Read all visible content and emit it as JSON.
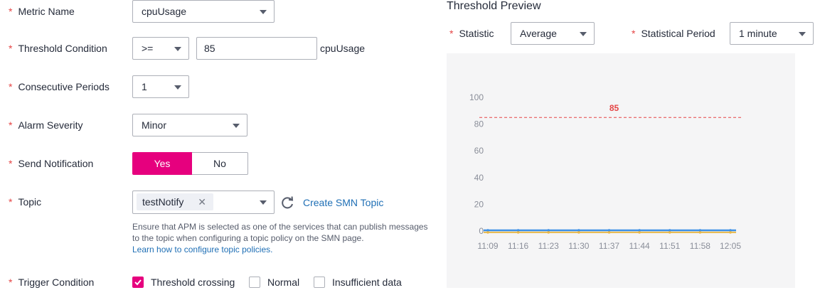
{
  "form": {
    "metric_name": {
      "label": "Metric Name",
      "value": "cpuUsage"
    },
    "threshold_condition": {
      "label": "Threshold Condition",
      "operator": ">=",
      "value": "85",
      "unit": "cpuUsage"
    },
    "consecutive_periods": {
      "label": "Consecutive Periods",
      "value": "1"
    },
    "alarm_severity": {
      "label": "Alarm Severity",
      "value": "Minor"
    },
    "send_notification": {
      "label": "Send Notification",
      "yes": "Yes",
      "no": "No",
      "selected": "Yes"
    },
    "topic": {
      "label": "Topic",
      "tag": "testNotify",
      "tag_remove": "✕",
      "create_link": "Create SMN Topic",
      "hint_line1": "Ensure that APM is selected as one of the services that can publish messages",
      "hint_line2": "to the topic when configuring a topic policy on the SMN page.",
      "hint_link": "Learn how to configure topic policies."
    },
    "trigger_condition": {
      "label": "Trigger Condition",
      "options": [
        {
          "label": "Threshold crossing",
          "checked": true
        },
        {
          "label": "Normal",
          "checked": false
        },
        {
          "label": "Insufficient data",
          "checked": false
        }
      ]
    },
    "required_mark": "*"
  },
  "preview": {
    "title": "Threshold Preview",
    "statistic": {
      "label": "Statistic",
      "value": "Average"
    },
    "period": {
      "label": "Statistical Period",
      "value": "1 minute"
    }
  },
  "colors": {
    "accent": "#e6007e",
    "threshold": "#e54545",
    "series_primary": "#3d8fe6",
    "series_secondary": "#e8b84b",
    "link": "#1f6fb5"
  },
  "chart_data": {
    "type": "line",
    "yticks": [
      "100",
      "80",
      "60",
      "40",
      "20",
      "0"
    ],
    "ylim": [
      0,
      100
    ],
    "x": [
      "11:09",
      "11:16",
      "11:23",
      "11:30",
      "11:37",
      "11:44",
      "11:51",
      "11:58",
      "12:05"
    ],
    "threshold": {
      "value": 85,
      "label": "85"
    },
    "series": [
      {
        "values": [
          0.5,
          0.5,
          0.5,
          0.5,
          0.5,
          0.5,
          0.5,
          0.5,
          0.5
        ]
      },
      {
        "values": [
          -1,
          -1,
          -1,
          -1,
          -1,
          -1,
          -1,
          -1,
          -1
        ]
      }
    ],
    "grid": false
  }
}
